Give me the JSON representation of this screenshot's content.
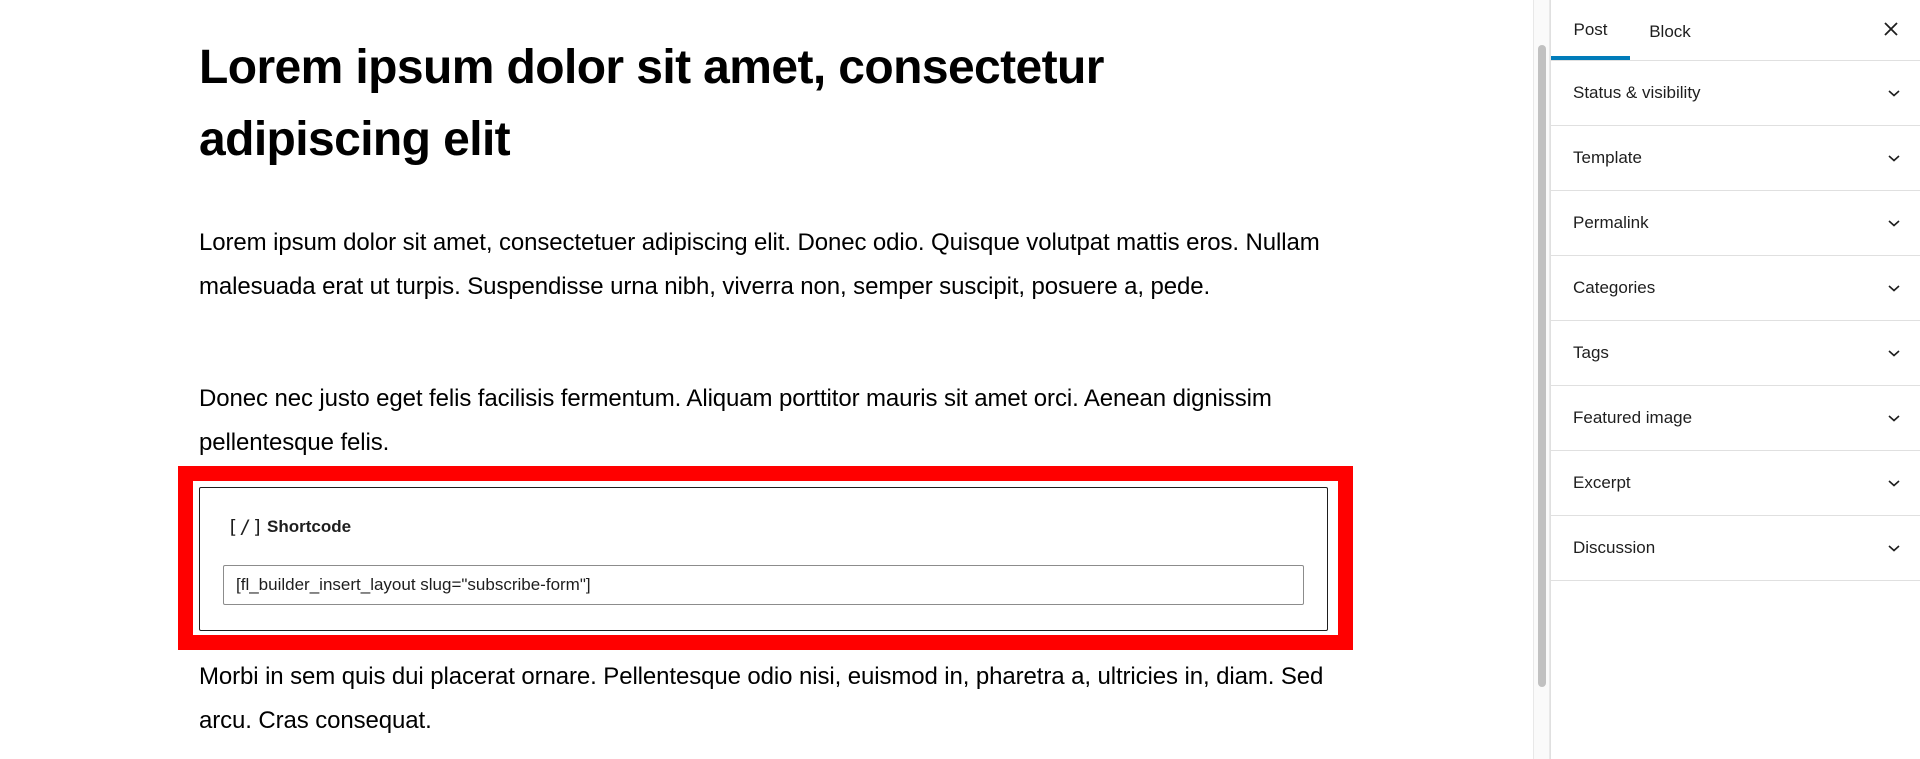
{
  "editor": {
    "title": "Lorem ipsum dolor sit amet, consectetur adipiscing elit",
    "paragraphs": [
      "Lorem ipsum dolor sit amet, consectetuer adipiscing elit. Donec odio. Quisque volutpat mattis eros. Nullam malesuada erat ut turpis. Suspendisse urna nibh, viverra non, semper suscipit, posuere a, pede.",
      "Donec nec justo eget felis facilisis fermentum. Aliquam porttitor mauris sit amet orci. Aenean dignissim pellentesque felis.",
      "Morbi in sem quis dui placerat ornare. Pellentesque odio nisi, euismod in, pharetra a, ultricies in, diam. Sed arcu. Cras consequat."
    ],
    "shortcode_block": {
      "icon": "shortcode-icon",
      "icon_glyph": "[/]",
      "label": "Shortcode",
      "value": "[fl_builder_insert_layout slug=\"subscribe-form\"]",
      "highlight_color": "#ff0000"
    }
  },
  "sidebar": {
    "tabs": [
      {
        "label": "Post",
        "active": true
      },
      {
        "label": "Block",
        "active": false
      }
    ],
    "close_icon": "close-icon",
    "accent_color": "#007cba",
    "panels": [
      {
        "label": "Status & visibility"
      },
      {
        "label": "Template"
      },
      {
        "label": "Permalink"
      },
      {
        "label": "Categories"
      },
      {
        "label": "Tags"
      },
      {
        "label": "Featured image"
      },
      {
        "label": "Excerpt"
      },
      {
        "label": "Discussion"
      }
    ]
  }
}
